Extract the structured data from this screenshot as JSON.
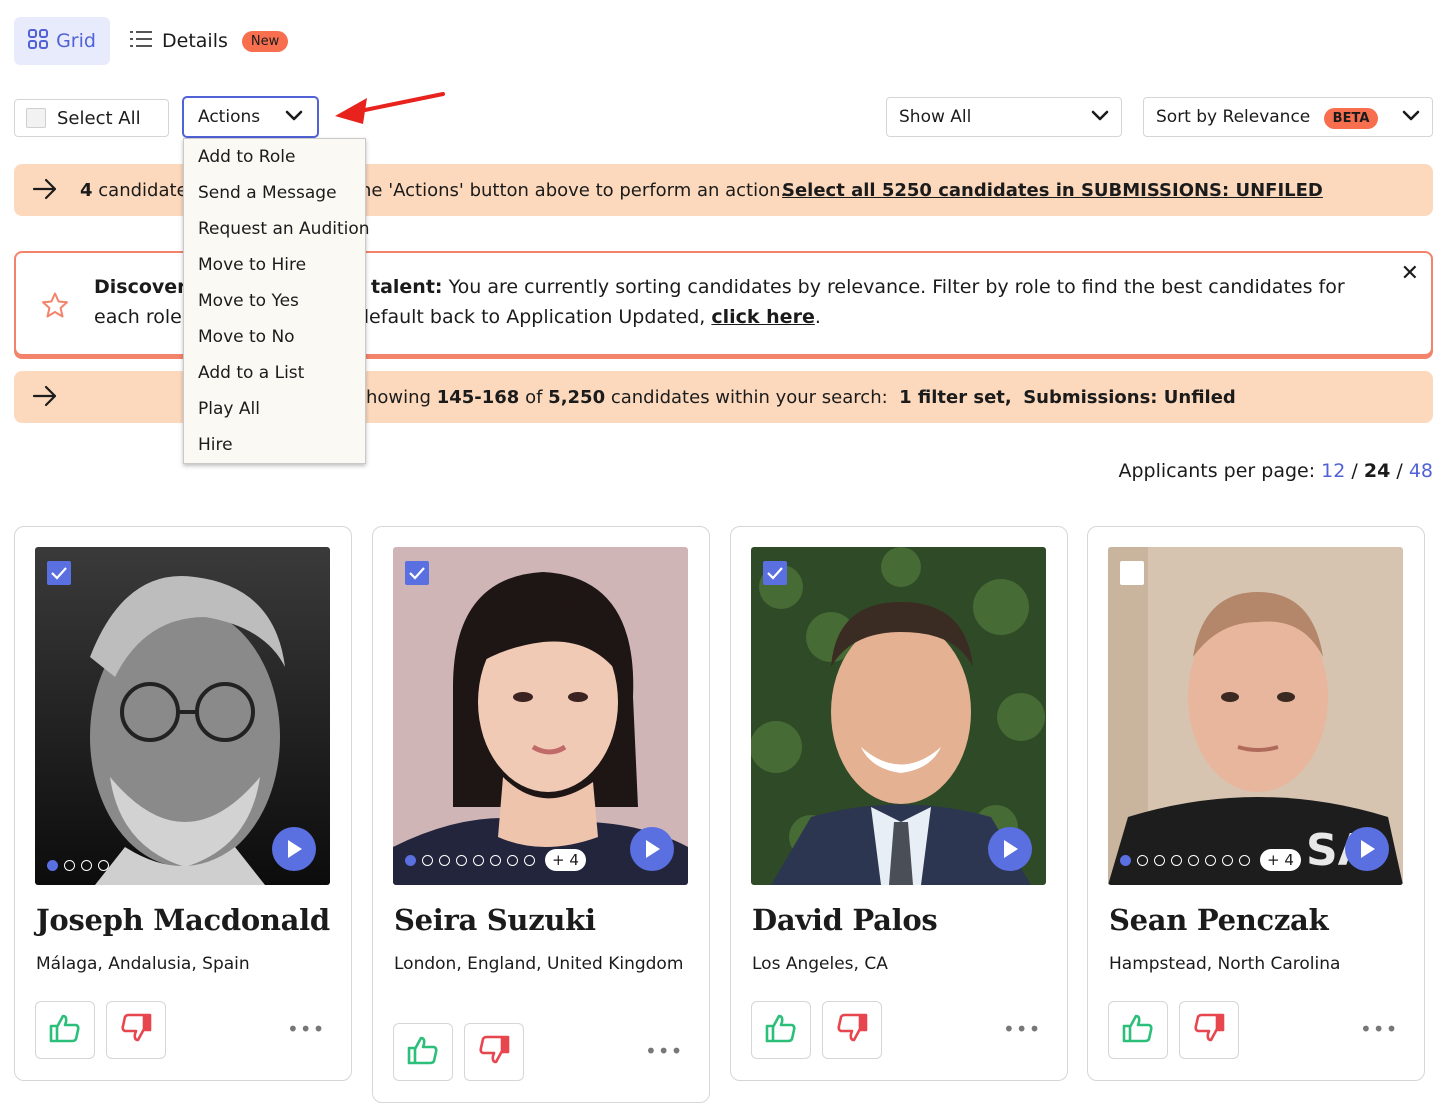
{
  "view_tabs": {
    "grid": "Grid",
    "details": "Details",
    "details_badge": "New"
  },
  "toolbar": {
    "select_all": "Select All",
    "actions": "Actions",
    "show_all": "Show All",
    "sort_prefix": "Sort by",
    "sort_value": "Relevance",
    "sort_badge": "BETA"
  },
  "actions_menu": [
    "Add to Role",
    "Send a Message",
    "Request an Audition",
    "Move to Hire",
    "Move to Yes",
    "Move to No",
    "Add to a List",
    "Play All",
    "Hire"
  ],
  "banner_selected": {
    "count": "4",
    "text_a": "candidate",
    "text_b": "ne 'Actions' button above to perform an action.",
    "link": "Select all 5250 candidates in SUBMISSIONS: UNFILED"
  },
  "discover": {
    "title_a": "Discover",
    "title_b": "talent:",
    "line1": "You are currently sorting candidates by relevance. Filter by role to find the best candidates for",
    "line2_a": "each role",
    "line2_b": "default back to Application Updated,",
    "link": "click here",
    "end": "."
  },
  "banner_results": {
    "prefix": "howing",
    "range": "145-168",
    "of": "of",
    "total": "5,250",
    "middle": "candidates within your search:",
    "filters": "1 filter set",
    "sep": ",",
    "folder": "Submissions: Unfiled"
  },
  "per_page": {
    "label": "Applicants per page:",
    "opt1": "12",
    "opt2": "24",
    "opt3": "48",
    "sep": "/"
  },
  "colors": {
    "accent": "#5062d6",
    "peach": "#fcd9bd",
    "coral": "#f76f4f",
    "thumb_up": "#2bbf7a",
    "thumb_down": "#e8464f"
  },
  "candidates": [
    {
      "name": "Joseph Macdonald",
      "location": "Málaga, Andalusia, Spain",
      "selected": true,
      "media_count": 4,
      "extra_media": ""
    },
    {
      "name": "Seira Suzuki",
      "location": "London, England, United Kingdom",
      "selected": true,
      "media_count": 8,
      "extra_media": "+ 4"
    },
    {
      "name": "David Palos",
      "location": "Los Angeles, CA",
      "selected": true,
      "media_count": 0,
      "extra_media": ""
    },
    {
      "name": "Sean Penczak",
      "location": "Hampstead, North Carolina",
      "selected": false,
      "media_count": 8,
      "extra_media": "+ 4"
    }
  ]
}
